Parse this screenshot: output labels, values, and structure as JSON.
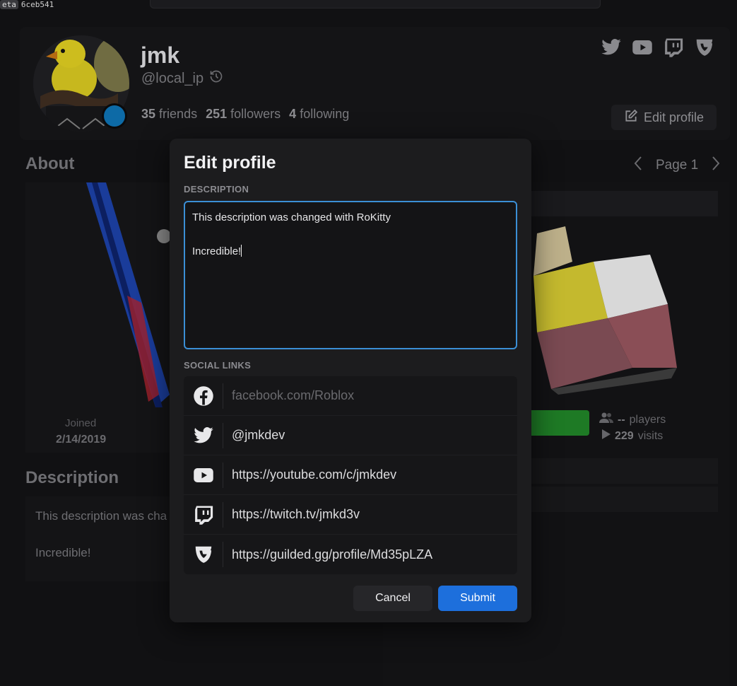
{
  "build": {
    "badge": "eta",
    "hash": "6ceb541"
  },
  "profile": {
    "display_name": "jmk",
    "username": "@local_ip",
    "friends_count": "35",
    "friends_label": "friends",
    "followers_count": "251",
    "followers_label": "followers",
    "following_count": "4",
    "following_label": "following",
    "edit_profile_label": "Edit profile",
    "social_icons": [
      "twitter-icon",
      "youtube-icon",
      "twitch-icon",
      "guilded-icon"
    ]
  },
  "about": {
    "title": "About",
    "joined_label": "Joined",
    "joined_value": "2/14/2019"
  },
  "description_section": {
    "title": "Description",
    "line1": "This description was cha",
    "line2": "Incredible!"
  },
  "creations": {
    "page_label": "Page 1",
    "players_value": "--",
    "players_label": "players",
    "visits_value": "229",
    "visits_label": "visits"
  },
  "modal": {
    "title": "Edit profile",
    "description_label": "DESCRIPTION",
    "description_line1": "This description was changed with RoKitty",
    "description_line2": "",
    "description_line3": "Incredible!",
    "social_label": "SOCIAL LINKS",
    "links": [
      {
        "icon": "facebook-icon",
        "value": "",
        "placeholder": "facebook.com/Roblox"
      },
      {
        "icon": "twitter-icon",
        "value": "@jmkdev",
        "placeholder": ""
      },
      {
        "icon": "youtube-icon",
        "value": "https://youtube.com/c/jmkdev",
        "placeholder": ""
      },
      {
        "icon": "twitch-icon",
        "value": "https://twitch.tv/jmkd3v",
        "placeholder": ""
      },
      {
        "icon": "guilded-icon",
        "value": "https://guilded.gg/profile/Md35pLZA",
        "placeholder": ""
      }
    ],
    "cancel_label": "Cancel",
    "submit_label": "Submit"
  },
  "colors": {
    "accent": "#1d6fdc",
    "focus_border": "#3b8fd6",
    "status": "#0d6aa6",
    "play": "#1e7a25"
  }
}
